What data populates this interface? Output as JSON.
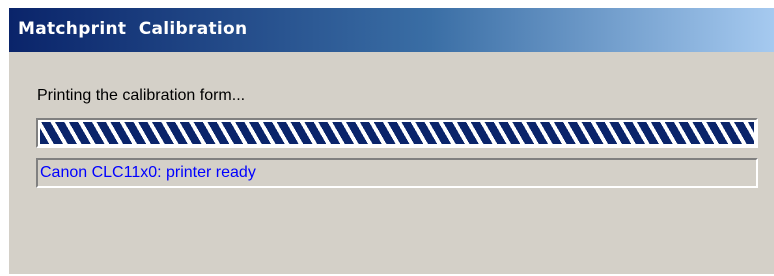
{
  "window": {
    "title": "Matchprint  Calibration"
  },
  "message": "Printing the calibration form...",
  "progress": {
    "value": 1.0,
    "style": "indeterminate-striped"
  },
  "status": {
    "text": "Canon CLC11x0: printer ready",
    "color": "#0000ff"
  },
  "colors": {
    "titlebar_start": "#0a246a",
    "titlebar_end": "#a6caf0",
    "dialog_background": "#d4d0c8",
    "progress_stripe": "#0a246a"
  }
}
